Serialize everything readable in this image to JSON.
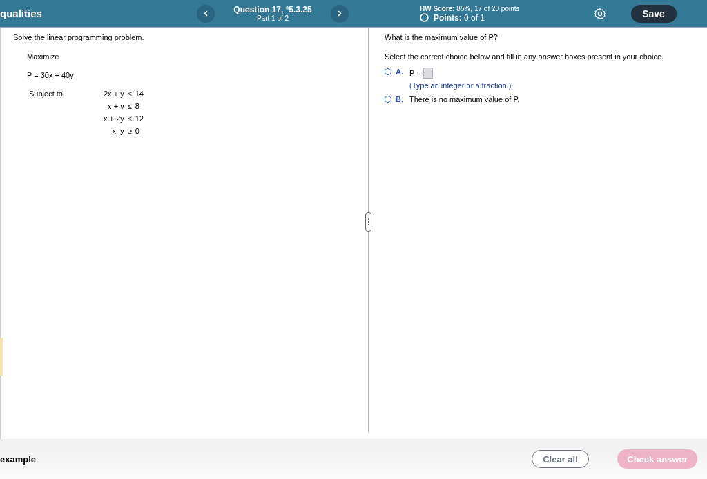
{
  "header": {
    "title": "qualities",
    "question": "Question 17, *5.3.25",
    "part": "Part 1 of 2",
    "hw_score_label": "HW Score:",
    "hw_score": "85%, 17 of 20 points",
    "points_label": "Points:",
    "points": "0 of 1",
    "save": "Save"
  },
  "problem": {
    "instruction": "Solve the linear programming problem.",
    "objective_label": "Maximize",
    "objective": "P = 30x + 40y",
    "subject_label": "Subject to",
    "constraints": [
      {
        "lhs": "2x + y",
        "op": "≤",
        "rhs": "14"
      },
      {
        "lhs": "x + y",
        "op": "≤",
        "rhs": "8"
      },
      {
        "lhs": "x + 2y",
        "op": "≤",
        "rhs": "12"
      },
      {
        "lhs": "x, y",
        "op": "≥",
        "rhs": "0"
      }
    ]
  },
  "answer": {
    "question": "What is the maximum value of P?",
    "instruction": "Select the correct choice below and fill in any answer boxes present in your choice.",
    "choices": [
      {
        "letter": "A.",
        "kind": "input",
        "text": "P =",
        "hint": "(Type an integer or a fraction.)",
        "selected": false
      },
      {
        "letter": "B.",
        "kind": "text",
        "text": "There is no maximum value of P.",
        "selected": false
      }
    ]
  },
  "footer": {
    "label": "example",
    "clear": "Clear all",
    "check": "Check answer",
    "check_disabled": true
  }
}
